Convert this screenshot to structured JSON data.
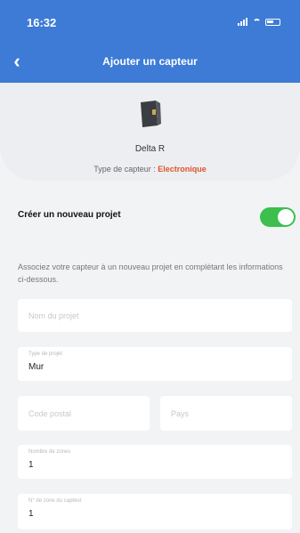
{
  "status_bar": {
    "time": "16:32"
  },
  "header": {
    "title": "Ajouter un capteur",
    "back_icon": "chevron-left-icon"
  },
  "device": {
    "name": "Delta R",
    "type_label": "Type de capteur :",
    "type_value": "Electronique"
  },
  "new_project": {
    "label": "Créer un nouveau projet",
    "enabled": true
  },
  "info_text": "Associez votre capteur à un nouveau projet en complétant les informations ci-dessous.",
  "form": {
    "project_name": {
      "placeholder": "Nom du projet",
      "value": ""
    },
    "project_type": {
      "label": "Type de projet",
      "value": "Mur"
    },
    "postal_code": {
      "placeholder": "Code postal",
      "value": ""
    },
    "country": {
      "placeholder": "Pays",
      "value": ""
    },
    "zone_count": {
      "label": "Nombre de zones",
      "value": "1"
    },
    "sensor_zone": {
      "label": "N° de zone du capteur",
      "value": "1"
    }
  },
  "colors": {
    "header": "#3d7bd6",
    "accent_orange": "#e0532c",
    "toggle_on": "#3cbf4d"
  }
}
